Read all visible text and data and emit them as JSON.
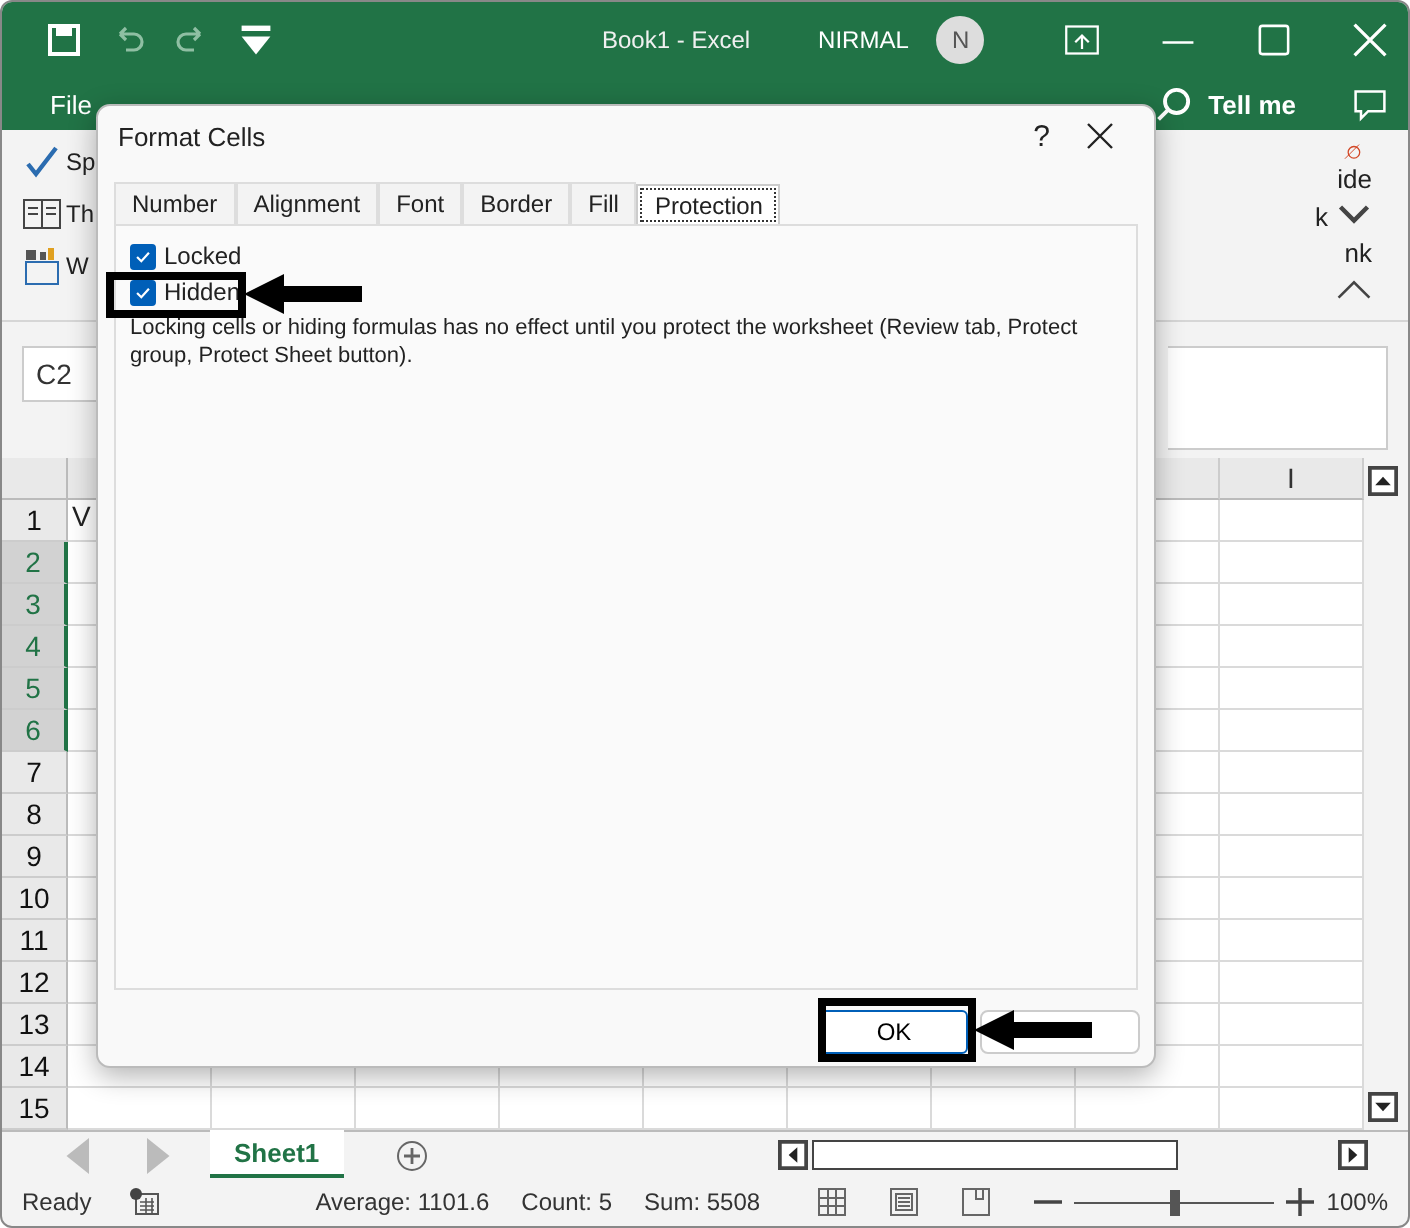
{
  "window": {
    "title": "Book1  -  Excel",
    "user": "NIRMAL",
    "avatar": "N"
  },
  "ribbon_tabs": [
    {
      "label": "File"
    },
    {
      "label": "Tell me"
    }
  ],
  "ribbon_left": [
    {
      "label": "Sp",
      "kind": "spell"
    },
    {
      "label": "Th",
      "kind": "thesaurus"
    },
    {
      "label": "W",
      "kind": "count"
    }
  ],
  "ribbon_right": [
    "ide",
    "k",
    "nk"
  ],
  "name_box": "C2",
  "cell_a1": "V",
  "column_header": "I",
  "rows": [
    {
      "label": "1",
      "selected": false
    },
    {
      "label": "2",
      "selected": true
    },
    {
      "label": "3",
      "selected": true
    },
    {
      "label": "4",
      "selected": true
    },
    {
      "label": "5",
      "selected": true
    },
    {
      "label": "6",
      "selected": true
    },
    {
      "label": "7",
      "selected": false
    },
    {
      "label": "8",
      "selected": false
    },
    {
      "label": "9",
      "selected": false
    },
    {
      "label": "10",
      "selected": false
    },
    {
      "label": "11",
      "selected": false
    },
    {
      "label": "12",
      "selected": false
    },
    {
      "label": "13",
      "selected": false
    },
    {
      "label": "14",
      "selected": false
    },
    {
      "label": "15",
      "selected": false
    }
  ],
  "sheet_tabs": [
    {
      "label": "Sheet1",
      "selected": true
    }
  ],
  "status_bar": {
    "mode": "Ready",
    "average": "Average: 1101.6",
    "count": "Count: 5",
    "sum": "Sum: 5508",
    "zoom": "100%",
    "zoom_slider": {
      "level": 0.5
    }
  },
  "dialog": {
    "title": "Format Cells",
    "help": "?",
    "tabs": [
      {
        "label": "Number",
        "selected": false
      },
      {
        "label": "Alignment",
        "selected": false
      },
      {
        "label": "Font",
        "selected": false
      },
      {
        "label": "Border",
        "selected": false
      },
      {
        "label": "Fill",
        "selected": false
      },
      {
        "label": "Protection",
        "selected": true
      }
    ],
    "checkboxes": [
      {
        "label": "Locked",
        "checked": true
      },
      {
        "label": "Hidden",
        "checked": true
      }
    ],
    "note": "Locking cells or hiding formulas has no effect until you protect the worksheet (Review tab, Protect group, Protect Sheet button).",
    "ok": "OK"
  }
}
